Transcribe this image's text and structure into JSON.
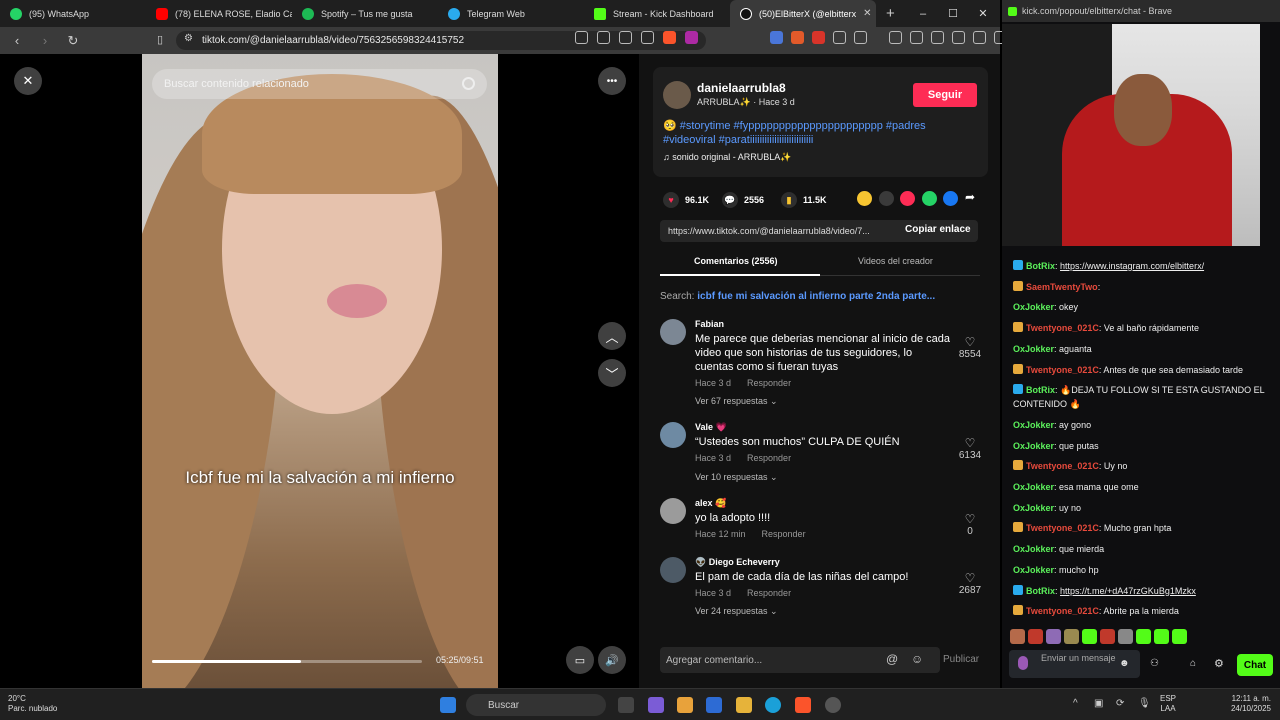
{
  "browser": {
    "tabs": [
      {
        "label": "(95) WhatsApp",
        "color": "#25d366"
      },
      {
        "label": "(78) ELENA ROSE, Eladio Carrió",
        "color": "#ff0000"
      },
      {
        "label": "Spotify – Tus me gusta",
        "color": "#1db954"
      },
      {
        "label": "Telegram Web",
        "color": "#2aabee"
      },
      {
        "label": "Stream - Kick Dashboard",
        "color": "#53fc18"
      },
      {
        "label": "(50)ElBitterX (@elbitterx",
        "color": "#111111"
      }
    ],
    "new_tab": "+",
    "url": "tiktok.com/@danielaarrubla8/video/7563256598324415752",
    "window_controls": {
      "minimize": "–",
      "maximize": "☐",
      "close": "✕"
    }
  },
  "player": {
    "search_placeholder": "Buscar contenido relacionado",
    "caption": "Icbf fue mi la salvación a mi infierno",
    "time": "05:25/09:51",
    "progress_fraction": 0.55,
    "close": "✕",
    "more": "•••",
    "up": "︿",
    "down": "﹀"
  },
  "post": {
    "username": "danielaarrubla8",
    "subline": "ARRUBLA✨ · Hace 3 d",
    "follow_label": "Seguir",
    "description": "🥺 #storytime #fypppppppppppppppppppppp #padres #videoviral #paratiiiiiiiiiiiiiiiiiiiiiiiiii",
    "sound": "♫  sonido original - ARRUBLA✨",
    "likes": "96.1K",
    "comments_count": "2556",
    "saves": "11.5K",
    "link": "https://www.tiktok.com/@danielaarrubla8/video/7...",
    "copy_label": "Copiar enlace",
    "tab_comments": "Comentarios (2556)",
    "tab_creator": "Videos del creador",
    "search_prefix": "Search:",
    "search_query": "icbf fue mi salvación al infierno parte 2nda parte...",
    "add_comment": "Agregar comentario...",
    "publish": "Publicar"
  },
  "comments": [
    {
      "user": "Fabian",
      "text": "Me parece que deberias mencionar al inicio de cada video que son historias de tus seguidores, lo cuentas como si fueran tuyas",
      "time": "Hace 3 d",
      "reply": "Responder",
      "likes": "8554",
      "more": "Ver 67 respuestas ⌄"
    },
    {
      "user": "Vale 💗",
      "text": "“Ustedes son muchos” CULPA DE QUIÉN",
      "time": "Hace 3 d",
      "reply": "Responder",
      "likes": "6134",
      "more": "Ver 10 respuestas ⌄"
    },
    {
      "user": "alex 🥰",
      "text": "yo la adopto !!!!",
      "time": "Hace 12 min",
      "reply": "Responder",
      "likes": "0",
      "more": ""
    },
    {
      "user": "👽 Diego Echeverry",
      "text": "El pam de cada día de las niñas del campo!",
      "time": "Hace 3 d",
      "reply": "Responder",
      "likes": "2687",
      "more": "Ver 24 respuestas ⌄"
    }
  ],
  "kick": {
    "title": "kick.com/popout/elbitterx/chat - Brave",
    "messages": [
      {
        "user": "BotRix",
        "cls": "bot",
        "text": "https://www.instagram.com/elbitterx/",
        "link": true
      },
      {
        "user": "SaemTwentyTwo",
        "cls": "tw",
        "text": "",
        "link": false
      },
      {
        "user": "OxJokker",
        "cls": "ox",
        "text": "okey",
        "link": false
      },
      {
        "user": "Twentyone_021C",
        "cls": "tw",
        "text": "Ve al baño rápidamente",
        "link": false
      },
      {
        "user": "OxJokker",
        "cls": "ox",
        "text": "aguanta",
        "link": false
      },
      {
        "user": "Twentyone_021C",
        "cls": "tw",
        "text": "Antes de que sea demasiado tarde",
        "link": false
      },
      {
        "user": "BotRix",
        "cls": "bot",
        "text": "🔥DEJA TU FOLLOW SI TE ESTA GUSTANDO EL CONTENIDO 🔥",
        "link": false
      },
      {
        "user": "OxJokker",
        "cls": "ox",
        "text": "ay gono",
        "link": false
      },
      {
        "user": "OxJokker",
        "cls": "ox",
        "text": "que putas",
        "link": false
      },
      {
        "user": "Twentyone_021C",
        "cls": "tw",
        "text": "Uy no",
        "link": false
      },
      {
        "user": "OxJokker",
        "cls": "ox",
        "text": "esa mama que ome",
        "link": false
      },
      {
        "user": "OxJokker",
        "cls": "ox",
        "text": "uy no",
        "link": false
      },
      {
        "user": "Twentyone_021C",
        "cls": "tw",
        "text": "Mucho gran hpta",
        "link": false
      },
      {
        "user": "OxJokker",
        "cls": "ox",
        "text": "que mierda",
        "link": false
      },
      {
        "user": "OxJokker",
        "cls": "ox",
        "text": "mucho hp",
        "link": false
      },
      {
        "user": "BotRix",
        "cls": "bot",
        "text": "https://t.me/+dA47rzGKuBg1Mzkx",
        "link": true
      },
      {
        "user": "Twentyone_021C",
        "cls": "tw",
        "text": "Abrite pa la mierda",
        "link": false
      }
    ],
    "input_placeholder": "Enviar un mensaje",
    "chat_button": "Chat"
  },
  "taskbar": {
    "weather_temp": "20°C",
    "weather_desc": "Parc. nublado",
    "search": "Buscar",
    "lang1": "ESP",
    "lang2": "LAA",
    "time": "12:11 a. m.",
    "date": "24/10/2025"
  }
}
